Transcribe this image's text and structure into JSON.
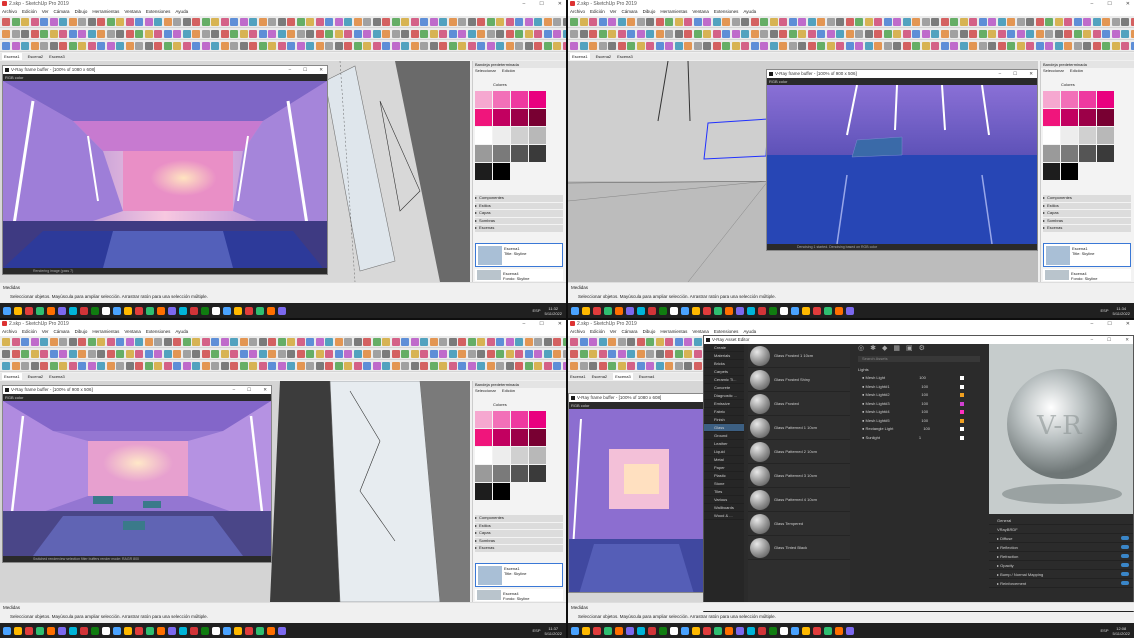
{
  "app_title": "2.skp - SketchUp Pro 2019",
  "menu": [
    "Archivo",
    "Edición",
    "Ver",
    "Cámara",
    "Dibujo",
    "Herramientas",
    "Ventana",
    "Extensiones",
    "Ayuda"
  ],
  "scene_tabs": [
    "Escena1",
    "Escena2",
    "Escena3",
    "Escena4"
  ],
  "tray": {
    "title": "Bandeja predeterminada",
    "tabs": [
      "Seleccionar",
      "Edición"
    ],
    "colors_label": "Colores",
    "panels": [
      "Componentes",
      "Estilos",
      "Capas",
      "Sombras",
      "Escenas"
    ],
    "scene1_name": "Escena1",
    "scene1_desc": "Title: Skyline",
    "scene2_name": "Escena4",
    "scene2_desc": "Fondo: Skyline"
  },
  "measure_label": "Medidas",
  "hint_text": "Seleccionar objetos. Mayúscula para ampliar selección. Arrastrar ratón para una selección múltiple.",
  "frame_buffer": {
    "title_q1": "V-Ray frame buffer - [100% of 1080 x 608]",
    "title_q2": "V-Ray frame buffer - [100% of 900 x 506]",
    "title_q3": "V-Ray frame buffer - [100% of 900 x 506]",
    "title_q4": "V-Ray frame buffer - [100% of 1080 x 608]",
    "channel": "RGB color",
    "foot_q1": "Rendering image (pass 7)",
    "foot_q2": "Denoising 1 started. Denoising based on RGB color",
    "foot_q3": "Switched renderview selection filter buffers render mode: RAGR 800"
  },
  "clock": {
    "q1": "11:32",
    "q2": "11:34",
    "q3": "11:37",
    "q4": "12:08",
    "date": "5/11/2022",
    "lang": "ESP"
  },
  "asset_editor": {
    "title": "V-Ray Asset Editor",
    "categories": [
      "Create",
      "Materials",
      "Bricks",
      "Carpets",
      "Ceramic Ti...",
      "Concrete",
      "Diagnostic ...",
      "Emissive",
      "Fabric",
      "Finish",
      "Glass",
      "Ground",
      "Leather",
      "Liquid",
      "Metal",
      "Paper",
      "Plastic",
      "Stone",
      "Tiles",
      "Various",
      "Wallboards",
      "Wood & ..."
    ],
    "selected_category": "Glass",
    "materials": [
      "Glass Frosted 1 10cm",
      "Glass Frosted Shiny",
      "Glass Frosted",
      "Glass Patterned 1 10cm",
      "Glass Patterned 2 10cm",
      "Glass Patterned 3 10cm",
      "Glass Patterned 4 10cm",
      "Glass Tempered",
      "Glass Tinted Black"
    ],
    "lights_title": "Lights",
    "search_placeholder": "Search Assets",
    "lights": [
      {
        "name": "Mesh Light",
        "val": "100",
        "color": "#ffffff"
      },
      {
        "name": "Mesh Light#1",
        "val": "100",
        "color": "#ffffff"
      },
      {
        "name": "Mesh Light#2",
        "val": "100",
        "color": "#f0a020"
      },
      {
        "name": "Mesh Light#3",
        "val": "100",
        "color": "#d040d0"
      },
      {
        "name": "Mesh Light#4",
        "val": "100",
        "color": "#ff30c0"
      },
      {
        "name": "Mesh Light#5",
        "val": "100",
        "color": "#f0a020"
      },
      {
        "name": "Rectangle Light",
        "val": "100",
        "color": "#ffffff"
      },
      {
        "name": "Sunlight",
        "val": "1",
        "color": "#ffffff"
      }
    ],
    "props": [
      "General",
      "VRayBRDF",
      "Diffuse",
      "Reflection",
      "Refraction",
      "Opacity",
      "Bump / Normal Mapping",
      "Reinforcement"
    ]
  },
  "swatch_colors": [
    "#f6a8d0",
    "#f270b8",
    "#ee3aa0",
    "#e9007f",
    "#f0157c",
    "#c20060",
    "#9c0048",
    "#780032",
    "#ffffff",
    "#ededed",
    "#d0d0d0",
    "#b8b8b8",
    "#9a9a9a",
    "#7a7a7a",
    "#555555",
    "#3a3a3a",
    "#1d1d1d",
    "#000000"
  ]
}
